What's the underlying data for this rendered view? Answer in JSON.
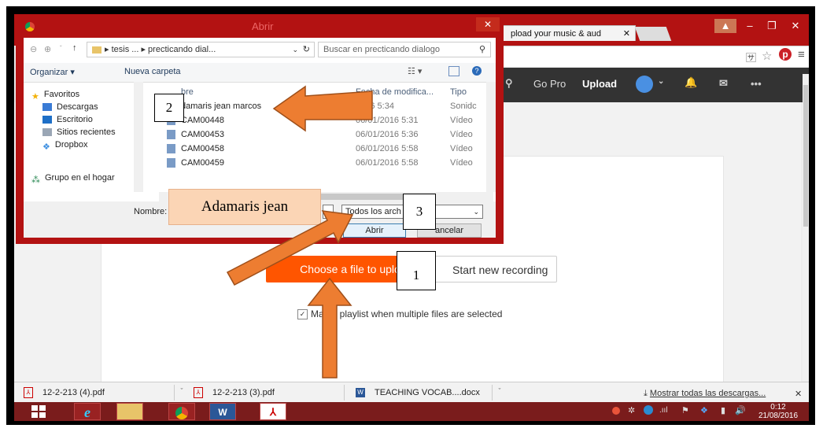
{
  "browser": {
    "tab_title": "pload your music & aud",
    "tab_close": "✕",
    "min": "–",
    "restore": "❐",
    "close": "✕",
    "account_badge": "▲"
  },
  "soundcloud": {
    "gopro": "Go Pro",
    "upload": "Upload",
    "more": "•••"
  },
  "upload_page": {
    "choose_btn": "Choose a file to uplo",
    "record_btn": "Start new recording",
    "playlist_checkbox_label": "Ma   a playlist when multiple files are selected"
  },
  "dialog": {
    "title": "Abrir",
    "close": "✕",
    "breadcrumb": "▸ tesis ... ▸ precticando dial...",
    "search_placeholder": "Buscar en precticando dialogo",
    "organize": "Organizar ▾",
    "new_folder": "Nueva carpeta",
    "sidebar": [
      "Favoritos",
      "Descargas",
      "Escritorio",
      "Sitios recientes",
      "Dropbox",
      "Grupo en el hogar"
    ],
    "columns": {
      "name": "bre",
      "date": "Fecha de modifica...",
      "type": "Tipo"
    },
    "files": [
      {
        "name": "damaris jean marcos",
        "date": "2016 5:34",
        "type": "Sonidc"
      },
      {
        "name": "CAM00448",
        "date": "06/01/2016 5:31",
        "type": "Vídeo"
      },
      {
        "name": "CAM00453",
        "date": "06/01/2016 5:36",
        "type": "Vídeo"
      },
      {
        "name": "CAM00458",
        "date": "06/01/2016 5:58",
        "type": "Vídeo"
      },
      {
        "name": "CAM00459",
        "date": "06/01/2016 5:58",
        "type": "Vídeo"
      }
    ],
    "filename_label": "Nombre:",
    "filetype": "Todos los arch",
    "open_btn": "Abrir",
    "cancel_btn": "ancelar"
  },
  "annotations": {
    "step1": "1",
    "step2": "2",
    "step3": "3",
    "name_box": "Adamaris jean"
  },
  "downloads": {
    "items": [
      "12-2-213 (4).pdf",
      "12-2-213 (3).pdf",
      "TEACHING VOCAB....docx"
    ],
    "show_all": "Mostrar todas las descargas...",
    "close": "✕"
  },
  "taskbar": {
    "time": "0:12",
    "date": "21/08/2016"
  },
  "colors": {
    "accent": "#ff5500",
    "dialog_frame": "#b31212",
    "arrow": "#ed7d31",
    "taskbar": "#7a1c1c"
  }
}
